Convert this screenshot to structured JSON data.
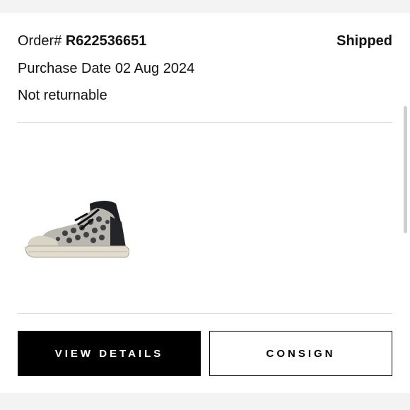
{
  "order": {
    "label": "Order#",
    "number": "R622536651",
    "status": "Shipped",
    "purchase_date_label": "Purchase Date",
    "purchase_date": "02 Aug 2024",
    "return_policy": "Not returnable"
  },
  "product": {
    "image_icon": "sneaker-image"
  },
  "actions": {
    "view_details_label": "VIEW DETAILS",
    "consign_label": "CONSIGN"
  },
  "colors": {
    "primary_button_bg": "#000000",
    "page_bg": "#f3f3f4",
    "card_bg": "#ffffff"
  }
}
